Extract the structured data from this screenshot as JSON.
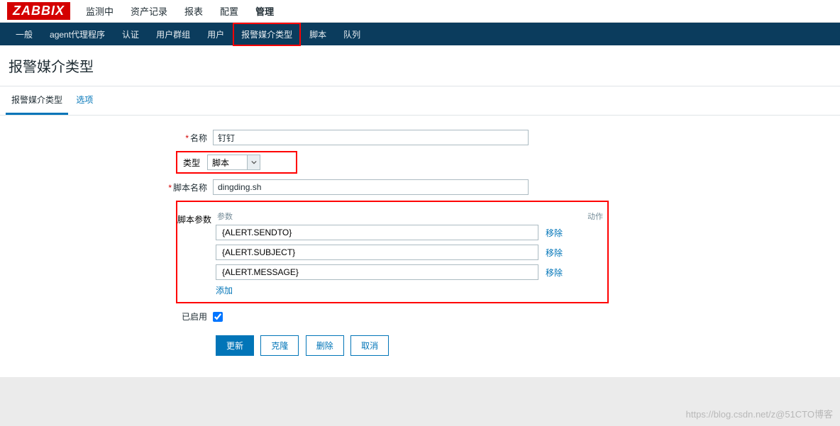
{
  "logo": "ZABBIX",
  "topnav": {
    "items": [
      "监测中",
      "资产记录",
      "报表",
      "配置",
      "管理"
    ],
    "active_index": 4
  },
  "subnav": {
    "items": [
      "一般",
      "agent代理程序",
      "认证",
      "用户群组",
      "用户",
      "报警媒介类型",
      "脚本",
      "队列"
    ],
    "active_index": 5
  },
  "page_title": "报警媒介类型",
  "tabs": {
    "items": [
      "报警媒介类型",
      "选项"
    ],
    "active_index": 0
  },
  "form": {
    "name_label": "名称",
    "name_value": "钉钉",
    "type_label": "类型",
    "type_value": "脚本",
    "script_name_label": "脚本名称",
    "script_name_value": "dingding.sh",
    "params_label": "脚本参数",
    "params_header_param": "参数",
    "params_header_action": "动作",
    "params": [
      {
        "value": "{ALERT.SENDTO}",
        "action": "移除"
      },
      {
        "value": "{ALERT.SUBJECT}",
        "action": "移除"
      },
      {
        "value": "{ALERT.MESSAGE}",
        "action": "移除"
      }
    ],
    "add_label": "添加",
    "enabled_label": "已启用",
    "enabled_checked": true
  },
  "buttons": {
    "update": "更新",
    "clone": "克隆",
    "delete": "删除",
    "cancel": "取消"
  },
  "watermark": "https://blog.csdn.net/z@51CTO博客"
}
